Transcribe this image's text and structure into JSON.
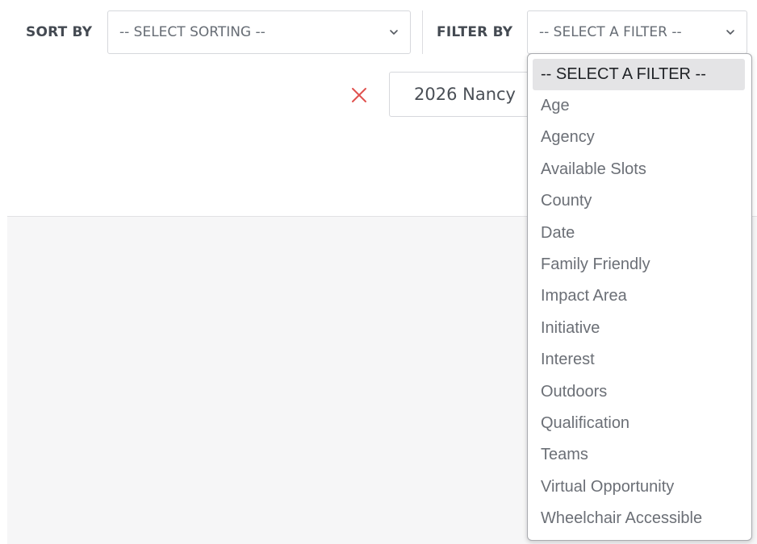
{
  "sort": {
    "label": "SORT BY",
    "selected": "-- SELECT SORTING --"
  },
  "filter": {
    "label": "FILTER BY",
    "selected": "-- SELECT A FILTER --",
    "options": [
      "-- SELECT A FILTER --",
      "Age",
      "Agency",
      "Available Slots",
      "County",
      "Date",
      "Family Friendly",
      "Impact Area",
      "Initiative",
      "Interest",
      "Outdoors",
      "Qualification",
      "Teams",
      "Virtual Opportunity",
      "Wheelchair Accessible"
    ]
  },
  "search": {
    "value": "2026 Nancy"
  },
  "icons": {
    "clear": "close-icon",
    "chevron": "chevron-down-icon"
  },
  "colors": {
    "clear_icon": "#e0524f",
    "selected_option_bg": "#e4e4e6"
  }
}
